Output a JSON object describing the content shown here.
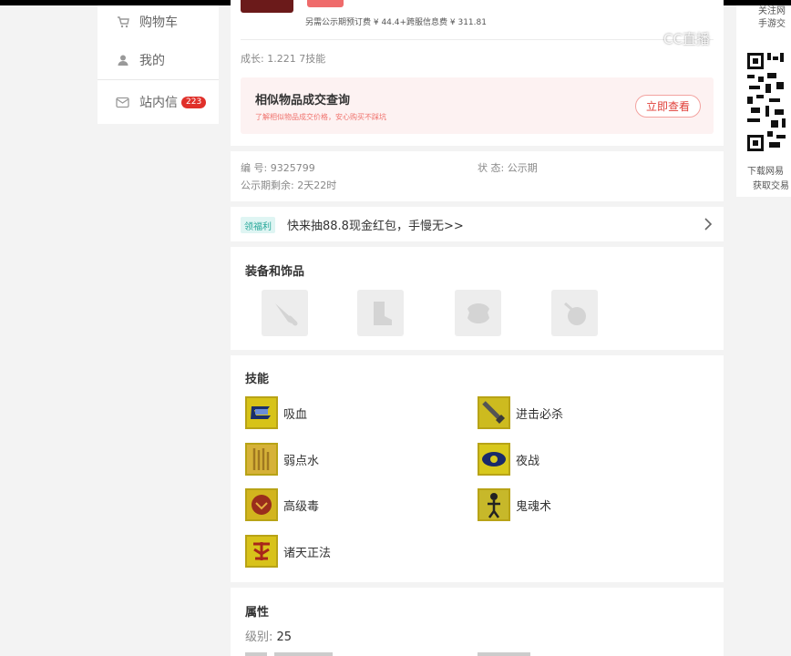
{
  "sidebar": {
    "items": [
      {
        "label": "购物车",
        "icon": "cart-icon"
      },
      {
        "label": "我的",
        "icon": "user-icon"
      },
      {
        "label": "站内信",
        "icon": "mail-icon",
        "badge": "223"
      }
    ]
  },
  "listing": {
    "fee_line": "另需公示期预订费 ¥ 44.4+跨服信息费 ¥ 311.81",
    "growth": "成长: 1.221 7技能"
  },
  "similar": {
    "title": "相似物品成交查询",
    "subtitle": "了解相似物品成交价格，安心购买不踩坑",
    "button": "立即查看"
  },
  "info": {
    "id_label": "编 号:",
    "id_value": "9325799",
    "status_label": "状 态:",
    "status_value": "公示期",
    "remaining_label": "公示期剩余:",
    "remaining_value": "2天22时"
  },
  "promo": {
    "tag": "领福利",
    "text": "快来抽88.8现金红包，手慢无>>"
  },
  "equipment": {
    "title": "装备和饰品",
    "slots": [
      "weapon-slot-icon",
      "boots-slot-icon",
      "armor-slot-icon",
      "accessory-slot-icon"
    ]
  },
  "skills": {
    "title": "技能",
    "items": [
      "吸血",
      "进击必杀",
      "弱点水",
      "夜战",
      "高级毒",
      "鬼魂术",
      "诸天正法"
    ]
  },
  "attributes": {
    "title": "属性",
    "level_label": "级别:",
    "level_value": "25"
  },
  "qr_panel": {
    "top_line1": "关注网",
    "top_line2": "手游交",
    "bottom_line1": "下载网易",
    "bottom_line2": "获取交易"
  },
  "watermark": "CC直播",
  "colors": {
    "accent_red": "#e0403a",
    "teal_tag": "#29a89a",
    "badge_red": "#e0302a"
  }
}
